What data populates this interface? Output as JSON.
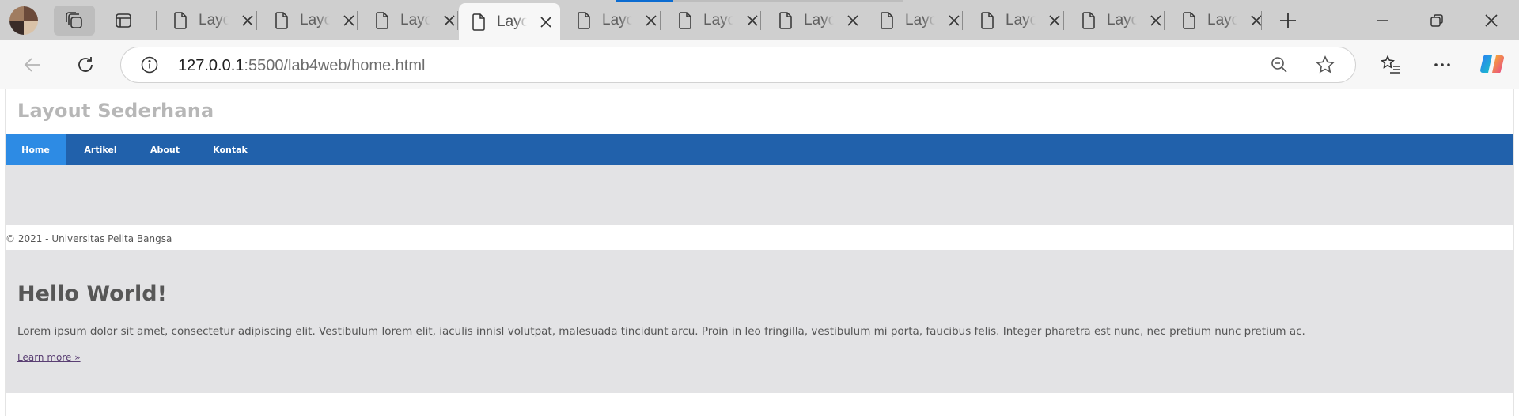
{
  "browser": {
    "tabs": [
      {
        "label": "Layout Sederhana",
        "active": false
      },
      {
        "label": "Layout Sederhana",
        "active": false
      },
      {
        "label": "Layout Sederhana",
        "active": false
      },
      {
        "label": "Layout Sederhana",
        "active": true
      },
      {
        "label": "Layout Sederhana",
        "active": false
      },
      {
        "label": "Layout Sederhana",
        "active": false
      },
      {
        "label": "Layout Sederhana",
        "active": false
      },
      {
        "label": "Layout Sederhana",
        "active": false
      },
      {
        "label": "Layout Sederhana",
        "active": false
      },
      {
        "label": "Layout Sederhana",
        "active": false
      },
      {
        "label": "Layout Sederhana",
        "active": false
      }
    ],
    "address": {
      "host": "127.0.0.1",
      "path": ":5500/lab4web/home.html"
    }
  },
  "page": {
    "site_title": "Layout Sederhana",
    "nav": [
      {
        "label": "Home",
        "active": true
      },
      {
        "label": "Artikel",
        "active": false
      },
      {
        "label": "About",
        "active": false
      },
      {
        "label": "Kontak",
        "active": false
      }
    ],
    "footer_text": "© 2021 - Universitas Pelita Bangsa",
    "hero": {
      "heading": "Hello World!",
      "body": "Lorem ipsum dolor sit amet, consectetur adipiscing elit. Vestibulum lorem elit, iaculis innisl volutpat, malesuada tincidunt arcu. Proin in leo fringilla, vestibulum mi porta, faucibus felis. Integer pharetra est nunc, nec pretium nunc pretium ac.",
      "link": "Learn more »"
    }
  },
  "colors": {
    "nav_bar": "#2161ab",
    "nav_active": "#2d8be4",
    "accent": "#0a6bd1"
  }
}
